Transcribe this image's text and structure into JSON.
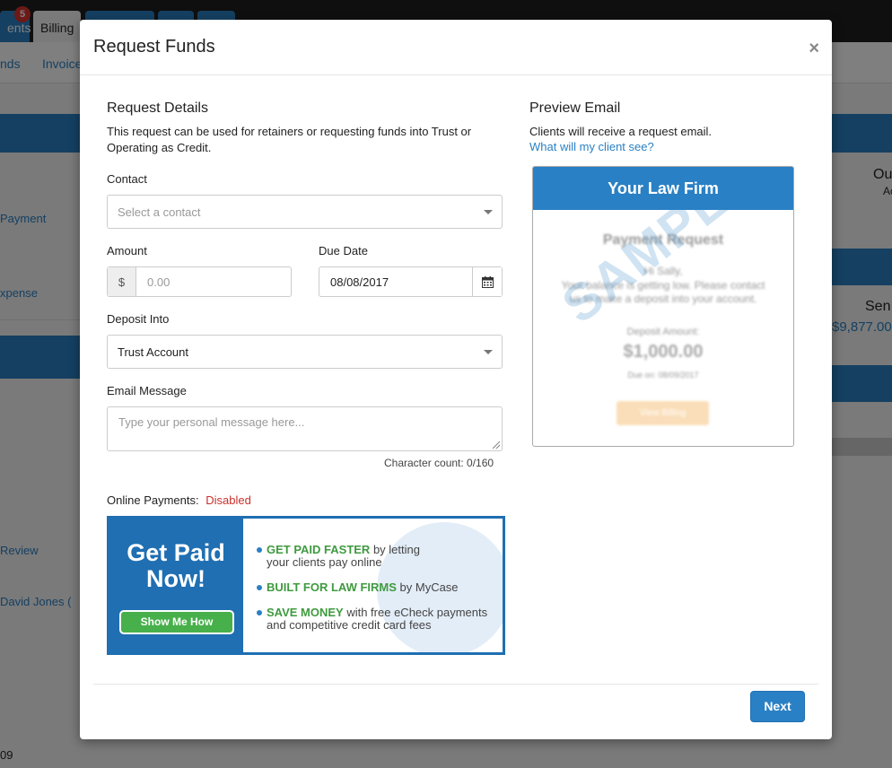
{
  "background": {
    "tabs": [
      {
        "label": "ents",
        "badge": "5"
      },
      {
        "label": "Billing"
      }
    ],
    "subnav": [
      "nds",
      "Invoice"
    ],
    "left_items": [
      "Payment",
      "xpense",
      "Review",
      "David Jones (",
      "09"
    ],
    "right_items": [
      "Ou",
      "Ac",
      "Sen",
      "$9,877.00"
    ]
  },
  "modal": {
    "title": "Request Funds",
    "close_label": "×",
    "details": {
      "title": "Request Details",
      "description": "This request can be used for retainers or requesting funds into Trust or Operating as Credit.",
      "contact_label": "Contact",
      "contact_placeholder": "Select a contact",
      "amount_label": "Amount",
      "amount_currency": "$",
      "amount_placeholder": "0.00",
      "due_date_label": "Due Date",
      "due_date_value": "08/08/2017",
      "deposit_label": "Deposit Into",
      "deposit_value": "Trust Account",
      "email_label": "Email Message",
      "email_placeholder": "Type your personal message here...",
      "char_count": "Character count: 0/160",
      "online_payments_label": "Online Payments:",
      "online_payments_status": "Disabled"
    },
    "banner": {
      "title_line1": "Get Paid",
      "title_line2": "Now!",
      "button": "Show Me How",
      "items": [
        {
          "highlight": "GET PAID FASTER",
          "rest1": " by letting",
          "rest2": "your clients pay online"
        },
        {
          "highlight": "BUILT FOR LAW FIRMS",
          "rest1": " by MyCase",
          "rest2": ""
        },
        {
          "highlight": "SAVE MONEY",
          "rest1": " with free eCheck payments",
          "rest2": "and competitive credit card fees"
        }
      ]
    },
    "preview": {
      "title": "Preview Email",
      "description": "Clients will receive a request email.",
      "link": "What will my client see?",
      "firm_name": "Your Law Firm",
      "request_title": "Payment Request",
      "greeting": "Hi Sally,",
      "body1": "Your balance is getting low. Please contact",
      "body2": "us to make a deposit into your account.",
      "deposit_amount_label": "Deposit Amount:",
      "deposit_amount": "$1,000.00",
      "due_on": "Due on: 08/09/2017",
      "view_billing": "View Billing",
      "watermark": "SAMPLE"
    },
    "next_label": "Next"
  },
  "colors": {
    "primary": "#2a80c4",
    "success": "#47b04b",
    "danger": "#c9302c"
  }
}
